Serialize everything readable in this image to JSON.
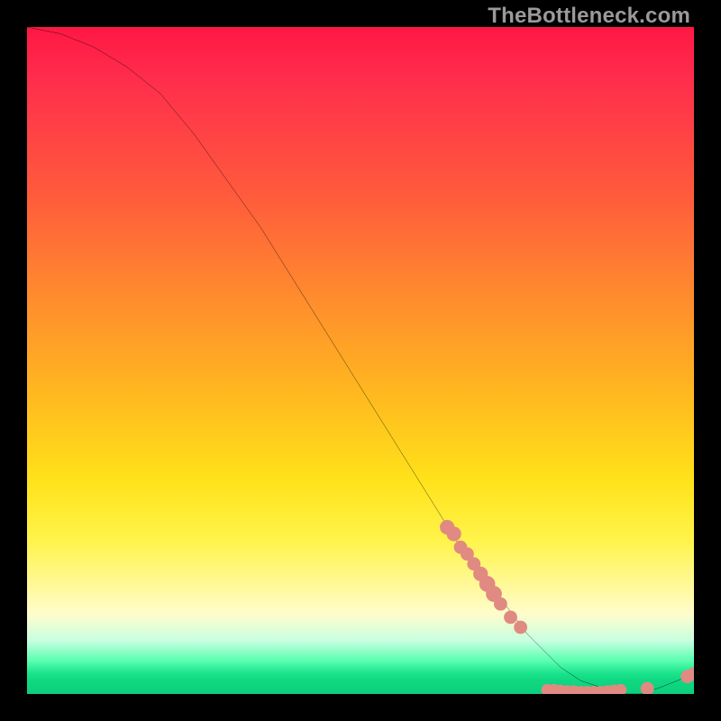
{
  "watermark": "TheBottleneck.com",
  "chart_data": {
    "type": "line",
    "title": "",
    "xlabel": "",
    "ylabel": "",
    "xlim": [
      0,
      100
    ],
    "ylim": [
      0,
      100
    ],
    "grid": false,
    "legend": false,
    "series": [
      {
        "name": "bottleneck-curve",
        "x": [
          0,
          5,
          10,
          15,
          20,
          25,
          30,
          35,
          40,
          45,
          50,
          55,
          60,
          65,
          68,
          72,
          75,
          78,
          80,
          83,
          86,
          89,
          92,
          95,
          100
        ],
        "y": [
          100,
          99,
          97,
          94,
          90,
          84,
          77,
          70,
          62,
          54,
          46,
          38,
          30,
          22,
          18,
          13,
          9,
          6,
          4,
          2,
          1,
          0,
          0,
          1,
          3
        ],
        "color": "#000000"
      }
    ],
    "markers": [
      {
        "name": "cluster-point",
        "x": 63,
        "y": 25,
        "r": 1.1,
        "color": "#e08a82"
      },
      {
        "name": "cluster-point",
        "x": 64,
        "y": 24,
        "r": 1.1,
        "color": "#e08a82"
      },
      {
        "name": "cluster-point",
        "x": 65,
        "y": 22,
        "r": 1.0,
        "color": "#e08a82"
      },
      {
        "name": "cluster-point",
        "x": 66,
        "y": 21,
        "r": 1.0,
        "color": "#e08a82"
      },
      {
        "name": "cluster-point",
        "x": 67,
        "y": 19.5,
        "r": 1.0,
        "color": "#e08a82"
      },
      {
        "name": "cluster-point",
        "x": 68,
        "y": 18,
        "r": 1.1,
        "color": "#e08a82"
      },
      {
        "name": "cluster-point",
        "x": 69,
        "y": 16.5,
        "r": 1.2,
        "color": "#e08a82"
      },
      {
        "name": "cluster-point",
        "x": 70,
        "y": 15,
        "r": 1.2,
        "color": "#e08a82"
      },
      {
        "name": "cluster-point",
        "x": 71,
        "y": 13.5,
        "r": 1.0,
        "color": "#e08a82"
      },
      {
        "name": "cluster-point",
        "x": 72.5,
        "y": 11.5,
        "r": 1.0,
        "color": "#e08a82"
      },
      {
        "name": "cluster-point",
        "x": 74,
        "y": 10,
        "r": 1.0,
        "color": "#e08a82"
      },
      {
        "name": "cluster-point",
        "x": 78,
        "y": 0.6,
        "r": 0.9,
        "color": "#e08a82"
      },
      {
        "name": "cluster-point",
        "x": 79,
        "y": 0.6,
        "r": 0.9,
        "color": "#e08a82"
      },
      {
        "name": "cluster-point",
        "x": 80,
        "y": 0.5,
        "r": 0.9,
        "color": "#e08a82"
      },
      {
        "name": "cluster-point",
        "x": 81,
        "y": 0.4,
        "r": 0.9,
        "color": "#e08a82"
      },
      {
        "name": "cluster-point",
        "x": 82,
        "y": 0.4,
        "r": 0.9,
        "color": "#e08a82"
      },
      {
        "name": "cluster-point",
        "x": 83,
        "y": 0.3,
        "r": 0.9,
        "color": "#e08a82"
      },
      {
        "name": "cluster-point",
        "x": 84,
        "y": 0.3,
        "r": 0.9,
        "color": "#e08a82"
      },
      {
        "name": "cluster-point",
        "x": 85,
        "y": 0.3,
        "r": 0.9,
        "color": "#e08a82"
      },
      {
        "name": "cluster-point",
        "x": 86,
        "y": 0.3,
        "r": 0.9,
        "color": "#e08a82"
      },
      {
        "name": "cluster-point",
        "x": 87,
        "y": 0.4,
        "r": 0.9,
        "color": "#e08a82"
      },
      {
        "name": "cluster-point",
        "x": 88,
        "y": 0.5,
        "r": 0.9,
        "color": "#e08a82"
      },
      {
        "name": "cluster-point",
        "x": 89,
        "y": 0.6,
        "r": 0.9,
        "color": "#e08a82"
      },
      {
        "name": "cluster-point",
        "x": 93,
        "y": 0.8,
        "r": 1.0,
        "color": "#e08a82"
      },
      {
        "name": "cluster-point",
        "x": 99,
        "y": 2.6,
        "r": 1.0,
        "color": "#e08a82"
      },
      {
        "name": "cluster-point",
        "x": 100,
        "y": 3.0,
        "r": 1.0,
        "color": "#e08a82"
      }
    ]
  }
}
